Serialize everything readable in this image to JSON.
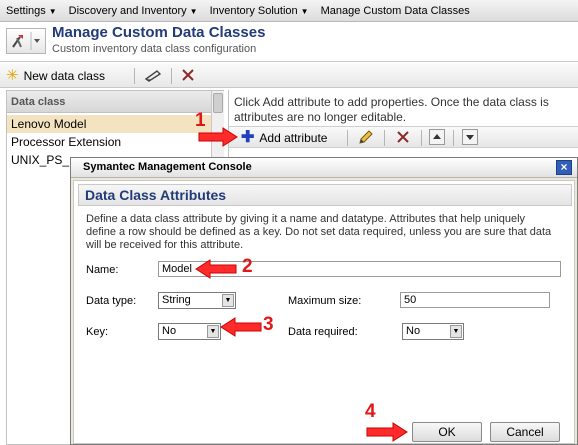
{
  "menubar": {
    "items": [
      {
        "label": "Settings",
        "has_caret": true
      },
      {
        "label": "Discovery and Inventory",
        "has_caret": true
      },
      {
        "label": "Inventory Solution",
        "has_caret": true
      },
      {
        "label": "Manage Custom Data Classes",
        "has_caret": false
      }
    ]
  },
  "header": {
    "title": "Manage Custom Data Classes",
    "subtitle": "Custom inventory data class configuration"
  },
  "toolbar": {
    "new_label": "New data class"
  },
  "left_panel": {
    "header": "Data class",
    "rows": [
      "Lenovo Model",
      "Processor Extension",
      "UNIX_PS_"
    ]
  },
  "right_panel": {
    "info": "Click Add attribute to add properties. Once the data class is attributes are no longer editable.",
    "add_attribute_label": "Add attribute"
  },
  "dialog": {
    "window_title": "Symantec Management Console",
    "heading": "Data Class Attributes",
    "description": "Define a data class attribute by giving it a name and datatype. Attributes that help uniquely define a row should be defined as a key. Do not set data required, unless you are sure that data will be received for this attribute.",
    "name_label": "Name:",
    "name_value": "Model",
    "data_type_label": "Data type:",
    "data_type_value": "String",
    "max_size_label": "Maximum size:",
    "max_size_value": "50",
    "key_label": "Key:",
    "key_value": "No",
    "data_required_label": "Data required:",
    "data_required_value": "No",
    "ok_label": "OK",
    "cancel_label": "Cancel",
    "close_symbol": "×"
  },
  "annotations": [
    "1",
    "2",
    "3",
    "4"
  ],
  "colors": {
    "title_blue": "#223b79",
    "annotation_red": "#e01818",
    "dialog_close_blue": "#2f5fb8",
    "selected_row": "#f3e3c0"
  }
}
